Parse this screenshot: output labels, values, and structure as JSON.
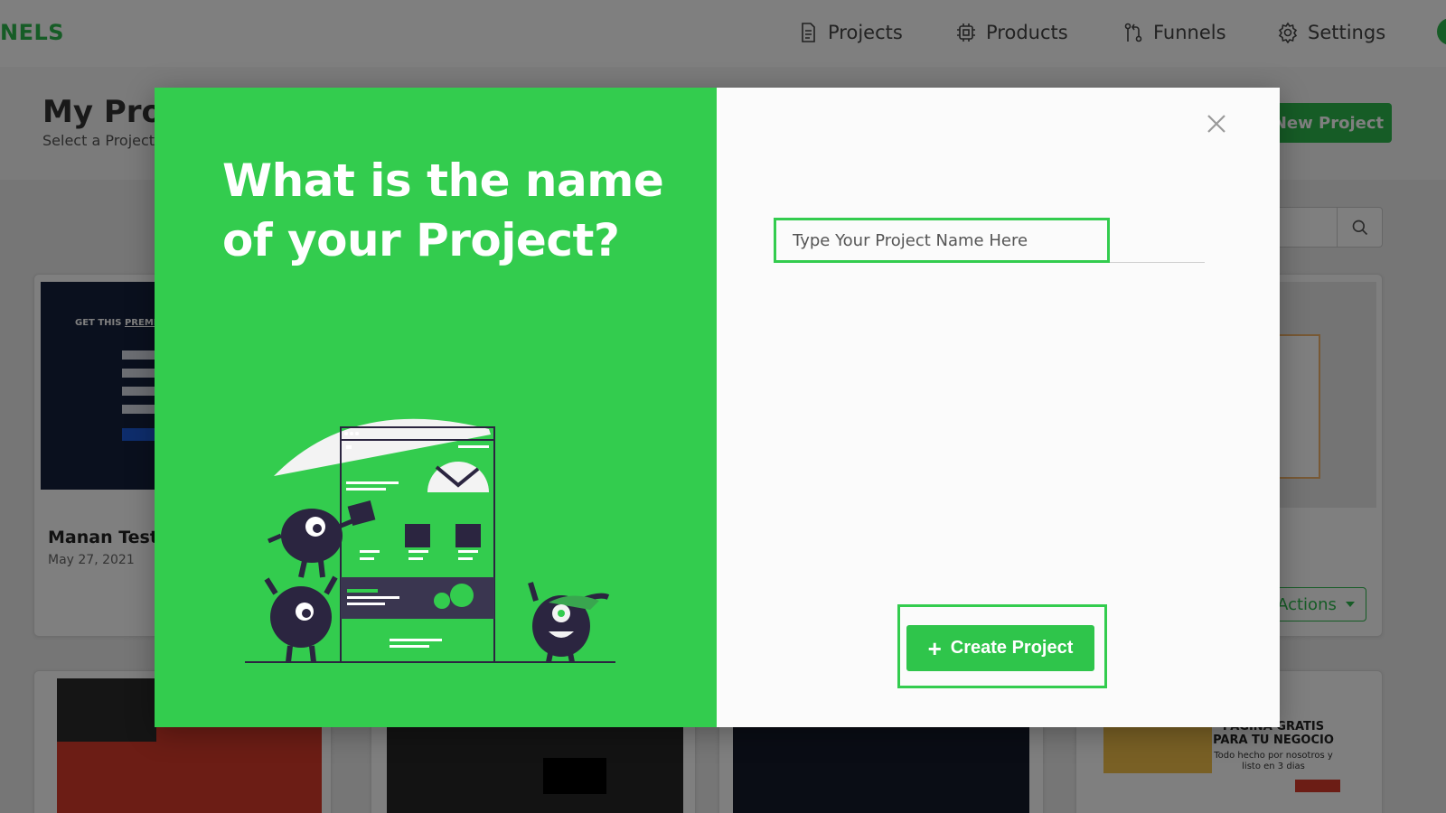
{
  "app": {
    "brand": "NELS",
    "nav": [
      {
        "label": "Projects",
        "icon": "document-icon"
      },
      {
        "label": "Products",
        "icon": "chip-icon"
      },
      {
        "label": "Funnels",
        "icon": "funnel-branch-icon"
      },
      {
        "label": "Settings",
        "icon": "gear-icon"
      }
    ]
  },
  "page": {
    "title": "My Proj",
    "subtitle": "Select a Project",
    "new_project_label": "New Project",
    "actions_label": "Actions"
  },
  "cards": [
    {
      "title": "Manan Testi",
      "date": "May 27, 2021"
    }
  ],
  "thumb_text": {
    "get_this": "GET THIS",
    "premium": "PREMIUM D",
    "spanish_title": "PAGINA GRATIS PARA TU NEGOCIO",
    "spanish_sub": "Todo hecho por nosotros y listo en 3 dias"
  },
  "modal": {
    "question": "What is the name of your Project?",
    "input_placeholder": "Type Your Project Name Here",
    "input_value": "",
    "create_label": "Create Project",
    "create_icon": "plus-icon",
    "close_icon": "close-icon"
  },
  "colors": {
    "brand_green": "#33cc4e",
    "button_green": "#2fc54b",
    "overlay": "rgba(0,0,0,0.5)"
  }
}
